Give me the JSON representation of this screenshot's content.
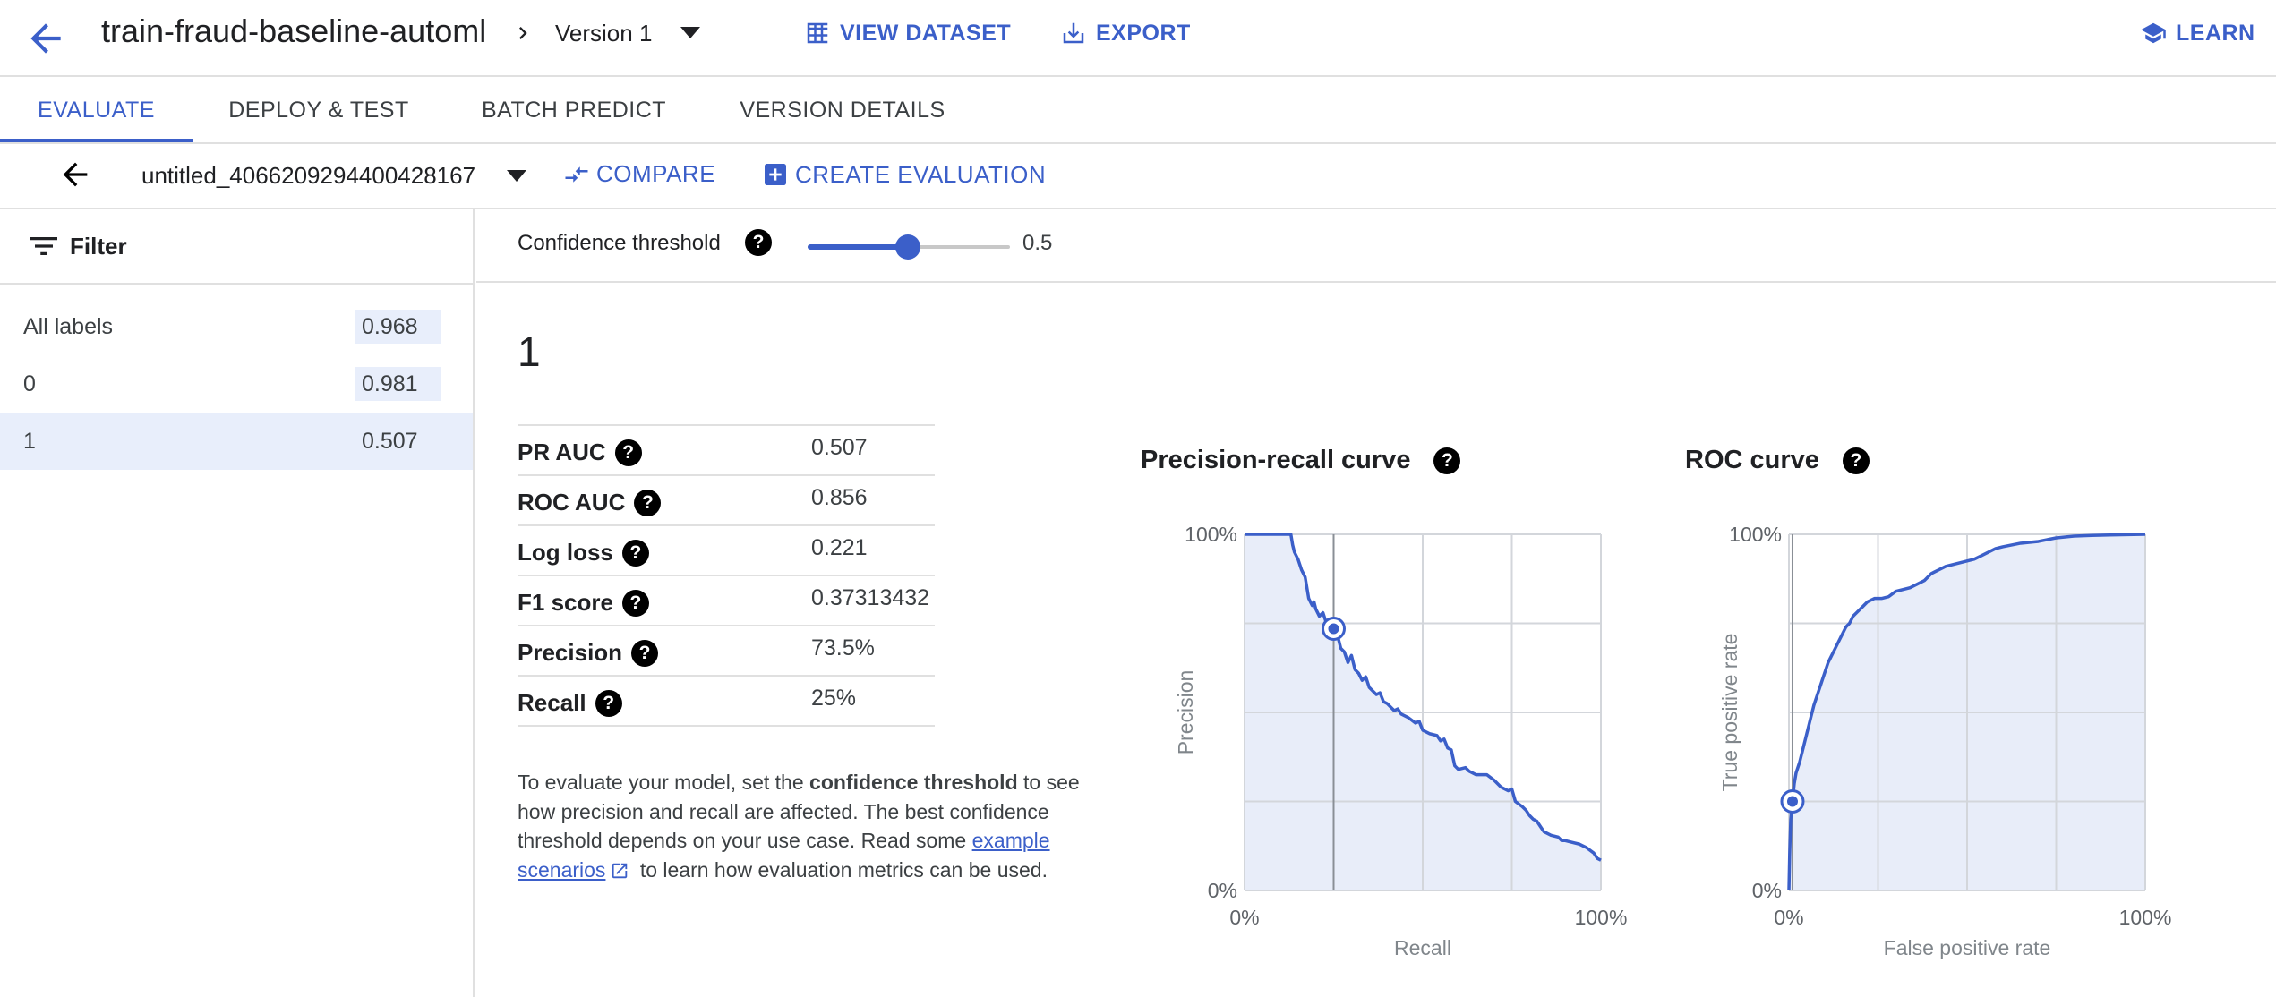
{
  "header": {
    "title": "train-fraud-baseline-automl",
    "version": "Version 1",
    "view_dataset": "VIEW DATASET",
    "export": "EXPORT",
    "learn": "LEARN"
  },
  "tabs": [
    {
      "label": "EVALUATE",
      "active": true
    },
    {
      "label": "DEPLOY & TEST",
      "active": false
    },
    {
      "label": "BATCH PREDICT",
      "active": false
    },
    {
      "label": "VERSION DETAILS",
      "active": false
    }
  ],
  "evaluation": {
    "name": "untitled_4066209294400428167",
    "compare": "COMPARE",
    "create": "CREATE EVALUATION"
  },
  "sidebar": {
    "filter": "Filter",
    "labels": [
      {
        "name": "All labels",
        "score": "0.968",
        "selected": false
      },
      {
        "name": "0",
        "score": "0.981",
        "selected": false
      },
      {
        "name": "1",
        "score": "0.507",
        "selected": true
      }
    ]
  },
  "confidence": {
    "label": "Confidence threshold",
    "value": "0.5",
    "level": 0.5
  },
  "selected_label": "1",
  "metrics": [
    {
      "name": "PR AUC",
      "value": "0.507"
    },
    {
      "name": "ROC AUC",
      "value": "0.856"
    },
    {
      "name": "Log loss",
      "value": "0.221"
    },
    {
      "name": "F1 score",
      "value": "0.37313432"
    },
    {
      "name": "Precision",
      "value": "73.5%"
    },
    {
      "name": "Recall",
      "value": "25%"
    }
  ],
  "help_glyph": "?",
  "description": {
    "part1": "To evaluate your model, set the ",
    "bold": "confidence threshold",
    "part2": " to see how precision and recall are affected. The best confidence threshold depends on your use case. Read some ",
    "link": "example scenarios",
    "part3": " to learn how evaluation metrics can be used."
  },
  "chart_data": [
    {
      "type": "line",
      "title": "Precision-recall curve",
      "xlabel": "Recall",
      "ylabel": "Precision",
      "x_ticks": [
        "0%",
        "100%"
      ],
      "y_ticks": [
        "0%",
        "100%"
      ],
      "xlim": [
        0,
        100
      ],
      "ylim": [
        0,
        100
      ],
      "grid": true,
      "x": [
        0,
        13,
        13.5,
        14,
        15,
        16,
        17,
        17.5,
        18,
        19,
        19.5,
        20,
        21,
        22,
        23,
        24,
        25,
        25.5,
        26,
        27,
        28,
        29,
        30,
        31,
        32,
        33,
        34,
        35,
        36,
        37,
        38,
        39,
        40,
        42,
        43,
        44,
        45,
        46,
        48,
        49,
        50,
        52,
        54,
        55,
        56,
        57,
        58,
        59,
        60,
        62,
        63,
        65,
        68,
        70,
        72,
        74,
        75,
        76,
        78,
        79,
        80,
        81,
        82,
        83,
        84,
        85,
        86,
        88,
        89,
        90,
        92,
        94,
        96,
        98,
        99,
        100
      ],
      "y": [
        100,
        100,
        97,
        95,
        93,
        90,
        88,
        85,
        82,
        80,
        81,
        79,
        77,
        78,
        75,
        74,
        73.5,
        71,
        72,
        68,
        67,
        64,
        66,
        62,
        61,
        59,
        60,
        57,
        56,
        55,
        55.5,
        53,
        52.5,
        50.5,
        51,
        49.5,
        49,
        48.5,
        47,
        47.5,
        45,
        44,
        43.5,
        42,
        42.5,
        40,
        39.5,
        35,
        34,
        34.5,
        33.5,
        32.5,
        32.5,
        31,
        29,
        28,
        28.5,
        25,
        23.5,
        22.5,
        21,
        20,
        19.5,
        18,
        16.5,
        16,
        15.5,
        15,
        14,
        14,
        13.5,
        13,
        12,
        10.5,
        9,
        8.5
      ],
      "marker": {
        "x": 25,
        "y": 73.5
      }
    },
    {
      "type": "area",
      "title": "ROC curve",
      "xlabel": "False positive rate",
      "ylabel": "True positive rate",
      "x_ticks": [
        "0%",
        "100%"
      ],
      "y_ticks": [
        "0%",
        "100%"
      ],
      "xlim": [
        0,
        100
      ],
      "ylim": [
        0,
        100
      ],
      "grid": true,
      "x": [
        0,
        0.2,
        0.5,
        1,
        1.5,
        2,
        3,
        4,
        5,
        6,
        7,
        8,
        9,
        10,
        11,
        12,
        13,
        14,
        15,
        16,
        17,
        18,
        19,
        20,
        22,
        24,
        26,
        28,
        30,
        32,
        34,
        36,
        38,
        40,
        42,
        44,
        46,
        48,
        50,
        52,
        54,
        56,
        58,
        60,
        65,
        70,
        75,
        80,
        85,
        90,
        95,
        100
      ],
      "y": [
        0,
        10,
        20,
        25,
        30,
        33,
        36,
        40,
        44,
        48,
        52,
        55,
        58,
        61,
        64,
        66,
        68,
        70,
        72,
        74,
        75,
        77,
        78,
        79,
        81,
        82,
        82,
        82.5,
        84,
        84.5,
        85,
        86,
        87,
        89,
        90,
        91,
        91.5,
        92,
        92.5,
        93,
        94,
        95,
        96,
        96.5,
        97.5,
        98,
        99,
        99.5,
        99.7,
        99.8,
        99.9,
        100
      ],
      "marker": {
        "x": 1,
        "y": 25
      }
    }
  ]
}
